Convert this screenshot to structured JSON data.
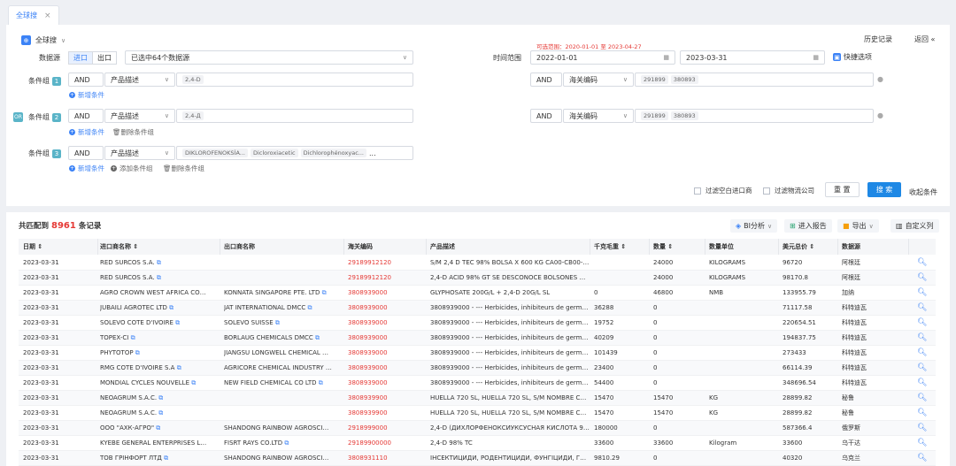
{
  "tab": {
    "label": "全球搜",
    "close": "×"
  },
  "header": {
    "title": "全球搜",
    "history": "历史记录",
    "back": "返回 «"
  },
  "source": {
    "label": "数据源",
    "opt_import": "进口",
    "opt_export": "出口",
    "selected": "已选中64个数据源"
  },
  "time": {
    "hint": "可选范围：2020-01-01 至 2023-04-27",
    "label": "时间范围",
    "start": "2022-01-01",
    "end": "2023-03-31",
    "quick": "快捷选项"
  },
  "groups": [
    {
      "label": "条件组",
      "num": "1",
      "op": "AND",
      "field": "产品描述",
      "tags": [
        "2,4-D"
      ],
      "op2": "AND",
      "field2": "海关编码",
      "tags2": [
        "291899",
        "380893"
      ],
      "actions": [
        "新增条件"
      ]
    },
    {
      "label": "条件组",
      "num": "2",
      "op": "AND",
      "field": "产品描述",
      "tags": [
        "2,4-Д"
      ],
      "op2": "AND",
      "field2": "海关编码",
      "tags2": [
        "291899",
        "380893"
      ],
      "actions": [
        "新增条件",
        "删除条件组"
      ]
    },
    {
      "label": "条件组",
      "num": "3",
      "op": "AND",
      "field": "产品描述",
      "tags": [
        "DIKLOROFENOKSİA...",
        "Dicloroxiacetic",
        "Dichlorophénoxyac..."
      ],
      "more": "...",
      "actions": [
        "新增条件",
        "添加条件组",
        "删除条件组"
      ]
    }
  ],
  "or_badge": "OR",
  "filters": {
    "empty_importer": "过滤空白进口商",
    "logistics": "过滤物流公司",
    "reset": "重 置",
    "search": "搜 索",
    "collapse": "收起条件"
  },
  "results": {
    "prefix": "共匹配到",
    "count": "8961",
    "suffix": "条记录",
    "toolbar": [
      "BI分析",
      "进入报告",
      "导出",
      "自定义列"
    ],
    "columns": [
      "日期",
      "进口商名称",
      "出口商名称",
      "海关编码",
      "产品描述",
      "千克毛重",
      "数量",
      "数量单位",
      "美元总价",
      "数据源"
    ],
    "rows": [
      [
        "2023-03-31",
        "RED SURCOS S.A.",
        "",
        "29189912120",
        "S/M 2,4 D TEC 98% BOLSA X 600 KG CA00-CB00-,2,4 D...",
        "",
        "24000",
        "KILOGRAMS",
        "96720",
        "阿根廷"
      ],
      [
        "2023-03-31",
        "RED SURCOS S.A.",
        "",
        "29189912120",
        "2,4-D ACID 98% GT SE DESCONOCE BOLSONES CA00-...",
        "",
        "24000",
        "KILOGRAMS",
        "98170.8",
        "阿根廷"
      ],
      [
        "2023-03-31",
        "AGRO CROWN WEST AFRICA COMP...",
        "KONNATA SINGAPORE PTE. LTD",
        "3808939000",
        "GLYPHOSATE 200G/L + 2,4-D 20G/L SL",
        "0",
        "46800",
        "NMB",
        "133955.79",
        "加纳"
      ],
      [
        "2023-03-31",
        "JUBAILI AGROTEC LTD",
        "JAT INTERNATIONAL DMCC",
        "3808939000",
        "3808939000 - --- Herbicides, inhibiteurs de germination ...",
        "36288",
        "0",
        "",
        "71117.58",
        "科特迪瓦"
      ],
      [
        "2023-03-31",
        "SOLEVO COTE D'IVOIRE",
        "SOLEVO SUISSE",
        "3808939000",
        "3808939000 - --- Herbicides, inhibiteurs de germination ...",
        "19752",
        "0",
        "",
        "220654.51",
        "科特迪瓦"
      ],
      [
        "2023-03-31",
        "TOPEX-CI",
        "BORLAUG CHEMICALS DMCC",
        "3808939000",
        "3808939000 - --- Herbicides, inhibiteurs de germination ...",
        "40209",
        "0",
        "",
        "194837.75",
        "科特迪瓦"
      ],
      [
        "2023-03-31",
        "PHYTOTOP",
        "JIANGSU LONGWELL CHEMICAL CO L...",
        "3808939000",
        "3808939000 - --- Herbicides, inhibiteurs de germination ...",
        "101439",
        "0",
        "",
        "273433",
        "科特迪瓦"
      ],
      [
        "2023-03-31",
        "RMG COTE D'IVOIRE S.A",
        "AGRICORE CHEMICAL INDUSTRY CO...",
        "3808939000",
        "3808939000 - --- Herbicides, inhibiteurs de germination ...",
        "23400",
        "0",
        "",
        "66114.39",
        "科特迪瓦"
      ],
      [
        "2023-03-31",
        "MONDIAL CYCLES NOUVELLE",
        "NEW FIELD CHEMICAL CO LTD",
        "3808939000",
        "3808939000 - --- Herbicides, inhibiteurs de germination ...",
        "54400",
        "0",
        "",
        "348696.54",
        "科特迪瓦"
      ],
      [
        "2023-03-31",
        "NEOAGRUM S.A.C.",
        "",
        "3808939900",
        "HUELLA 720 SL, HUELLA 720 SL, S/M NOMBRE COMERC...",
        "15470",
        "15470",
        "KG",
        "28899.82",
        "秘鲁"
      ],
      [
        "2023-03-31",
        "NEOAGRUM S.A.C.",
        "",
        "3808939900",
        "HUELLA 720 SL, HUELLA 720 SL, S/M NOMBRE COMERC...",
        "15470",
        "15470",
        "KG",
        "28899.82",
        "秘鲁"
      ],
      [
        "2023-03-31",
        "ООО \"АХК-АГРО\"",
        "SHANDONG RAINBOW AGROSCIENC...",
        "2918999000",
        "2,4-D (ДИХЛОРФЕНОКСИУКСУСНАЯ КИСЛОТА 98 %) ...",
        "180000",
        "0",
        "",
        "587366.4",
        "俄罗斯"
      ],
      [
        "2023-03-31",
        "KYEBE GENERAL ENTERPRISES LIMIT...",
        "FISRT RAYS CO.LTD",
        "29189900000",
        "2,4-D 98% TC",
        "33600",
        "33600",
        "Kilogram",
        "33600",
        "乌干达"
      ],
      [
        "2023-03-31",
        "ТОВ ГРІНФОРТ ЛТД",
        "SHANDONG RAINBOW AGROSCIENC...",
        "3808931110",
        "ІНСЕКТИЦИДИ, РОДЕНТИЦИДИ, ФУНГІЦИДИ, ГЕРБІ...",
        "9810.29",
        "0",
        "",
        "40320",
        "乌克兰"
      ]
    ]
  }
}
